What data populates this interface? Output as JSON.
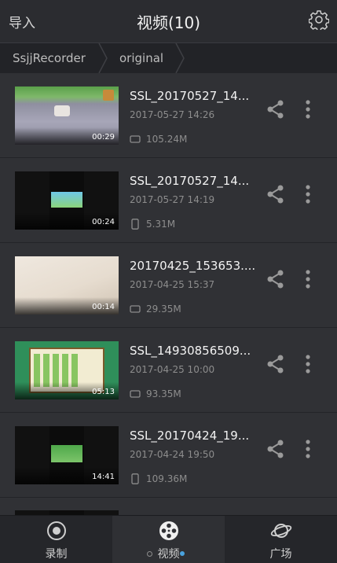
{
  "header": {
    "import_label": "导入",
    "title": "视频(10)",
    "settings_icon": "gear-icon"
  },
  "breadcrumb": {
    "items": [
      "SsjjRecorder",
      "original"
    ]
  },
  "videos": [
    {
      "name": "SSL_20170527_14...",
      "date": "2017-05-27 14:26",
      "size": "105.24M",
      "duration": "00:29",
      "device": "landscape"
    },
    {
      "name": "SSL_20170527_14...",
      "date": "2017-05-27 14:19",
      "size": "5.31M",
      "duration": "00:24",
      "device": "portrait"
    },
    {
      "name": "20170425_153653....",
      "date": "2017-04-25 15:37",
      "size": "29.35M",
      "duration": "00:14",
      "device": "landscape"
    },
    {
      "name": "SSL_14930856509...",
      "date": "2017-04-25 10:00",
      "size": "93.35M",
      "duration": "05:13",
      "device": "landscape"
    },
    {
      "name": "SSL_20170424_19...",
      "date": "2017-04-24 19:50",
      "size": "109.36M",
      "duration": "14:41",
      "device": "portrait"
    }
  ],
  "tabs": [
    {
      "label": "录制",
      "icon": "record-icon"
    },
    {
      "label": "视频",
      "icon": "film-reel-icon",
      "active": true
    },
    {
      "label": "广场",
      "icon": "planet-icon"
    }
  ],
  "colors": {
    "accent": "#4aa3df",
    "background": "#2e2f33"
  }
}
